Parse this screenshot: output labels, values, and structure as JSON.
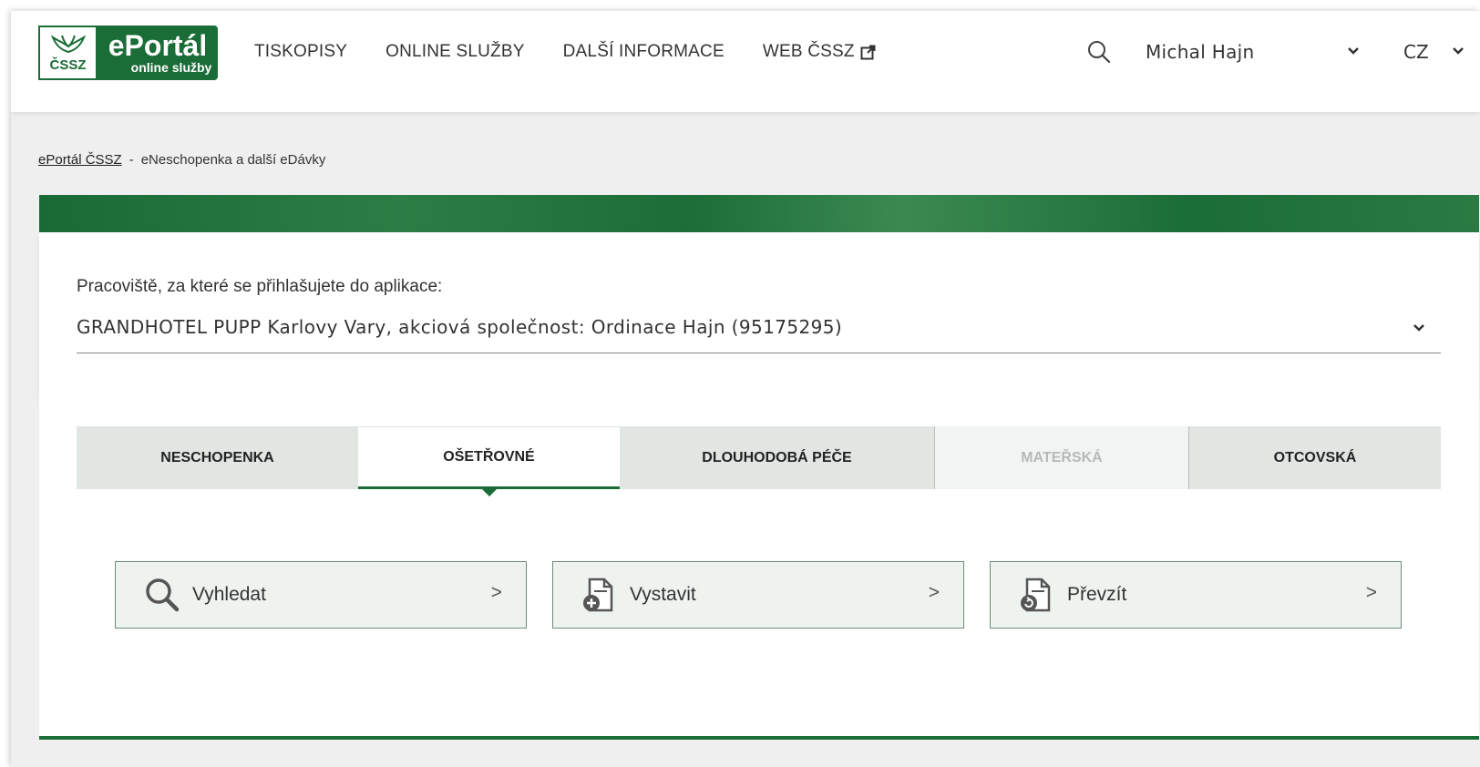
{
  "header": {
    "logo": {
      "brand": "ePortál",
      "subtitle": "online služby",
      "mark": "ČSSZ"
    },
    "nav": [
      {
        "label": "TISKOPISY"
      },
      {
        "label": "ONLINE SLUŽBY"
      },
      {
        "label": "DALŠÍ INFORMACE"
      },
      {
        "label": "WEB ČSSZ",
        "icon": "external-link-icon"
      }
    ],
    "user_name": "Michal Hajn",
    "language": "CZ"
  },
  "breadcrumb": {
    "root": "ePortál ČSSZ",
    "separator": "-",
    "current": "eNeschopenka a další eDávky"
  },
  "workplace": {
    "label": "Pracoviště, za které se přihlašujete do aplikace:",
    "selected": "GRANDHOTEL PUPP Karlovy Vary, akciová společnost: Ordinace Hajn (95175295)"
  },
  "tabs": [
    {
      "label": "NESCHOPENKA",
      "state": "default"
    },
    {
      "label": "OŠETŘOVNÉ",
      "state": "active"
    },
    {
      "label": "DLOUHODOBÁ PÉČE",
      "state": "default"
    },
    {
      "label": "MATEŘSKÁ",
      "state": "disabled"
    },
    {
      "label": "OTCOVSKÁ",
      "state": "default"
    }
  ],
  "actions": [
    {
      "label": "Vyhledat",
      "icon": "search-icon",
      "arrow": ">"
    },
    {
      "label": "Vystavit",
      "icon": "document-add-icon",
      "arrow": ">"
    },
    {
      "label": "Převzít",
      "icon": "document-transfer-icon",
      "arrow": ">"
    }
  ],
  "colors": {
    "brand_green": "#1b6d37",
    "tab_bg": "#e1e6e3",
    "button_bg": "#eef3ef"
  }
}
